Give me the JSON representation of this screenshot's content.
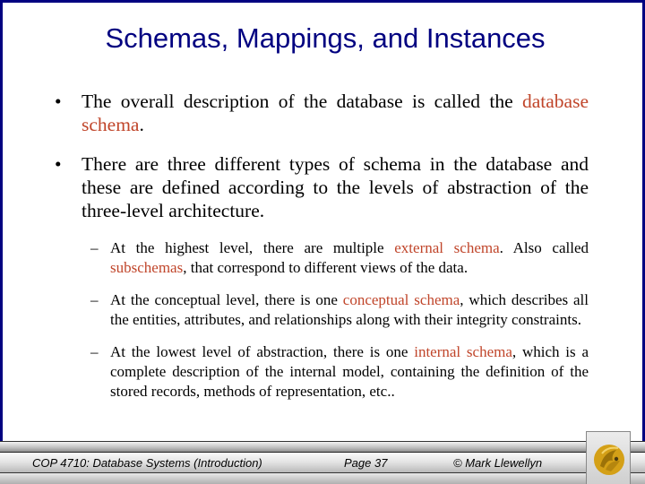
{
  "slide": {
    "title": "Schemas, Mappings, and Instances",
    "colors": {
      "title": "#000080",
      "border": "#000080",
      "highlight": "#C0452A",
      "body": "#000000"
    },
    "bullets": [
      {
        "parts": [
          {
            "text": "The overall description of the database is called the ",
            "highlight": false
          },
          {
            "text": "database schema",
            "highlight": true
          },
          {
            "text": ".",
            "highlight": false
          }
        ]
      },
      {
        "parts": [
          {
            "text": "There are three different types of schema in the database and these are defined according to the levels of abstraction of the three-level architecture.",
            "highlight": false
          }
        ]
      }
    ],
    "sub_bullets": [
      {
        "parts": [
          {
            "text": "At the highest level, there are multiple ",
            "highlight": false
          },
          {
            "text": "external schema",
            "highlight": true
          },
          {
            "text": ".  Also called ",
            "highlight": false
          },
          {
            "text": "subschemas",
            "highlight": true
          },
          {
            "text": ", that correspond to different views of the data.",
            "highlight": false
          }
        ]
      },
      {
        "parts": [
          {
            "text": "At the conceptual level, there is one ",
            "highlight": false
          },
          {
            "text": "conceptual schema",
            "highlight": true
          },
          {
            "text": ", which describes all the entities, attributes, and relationships along with their integrity constraints.",
            "highlight": false
          }
        ]
      },
      {
        "parts": [
          {
            "text": "At the lowest level of abstraction, there is one ",
            "highlight": false
          },
          {
            "text": "internal schema",
            "highlight": true
          },
          {
            "text": ", which is a complete description of the internal model, containing the definition of the stored records, methods of representation, etc..",
            "highlight": false
          }
        ]
      }
    ],
    "bullet_glyph": "•",
    "sub_bullet_glyph": "–"
  },
  "footer": {
    "course": "COP 4710: Database Systems  (Introduction)",
    "page": "Page 37",
    "copyright": "© Mark Llewellyn",
    "logo_icon": "pegasus-logo-icon",
    "logo_color": "#D4A017"
  }
}
